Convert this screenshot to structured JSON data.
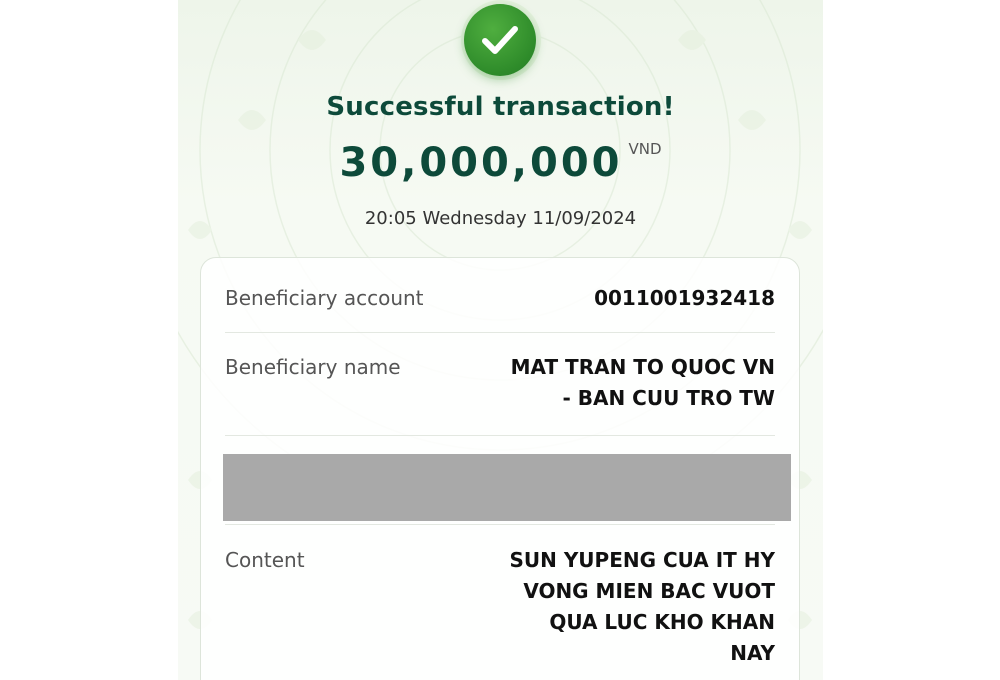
{
  "status": {
    "title": "Successful transaction!",
    "icon": "check-icon"
  },
  "amount": {
    "value": "30,000,000",
    "currency": "VND"
  },
  "datetime": "20:05 Wednesday 11/09/2024",
  "details": {
    "beneficiary_account": {
      "label": "Beneficiary account",
      "value": "0011001932418"
    },
    "beneficiary_name": {
      "label": "Beneficiary name",
      "value_line1": "MAT TRAN TO QUOC VN",
      "value_line2": "- BAN CUU TRO TW"
    },
    "content": {
      "label": "Content",
      "value_line1": "SUN YUPENG CUA IT HY",
      "value_line2": "VONG MIEN BAC VUOT",
      "value_line3": "QUA LUC KHO KHAN",
      "value_line4": "NAY"
    }
  },
  "colors": {
    "success_green": "#2e8b2a",
    "heading_dark_green": "#0d4a3a",
    "redaction_gray": "#a9a9a9"
  }
}
